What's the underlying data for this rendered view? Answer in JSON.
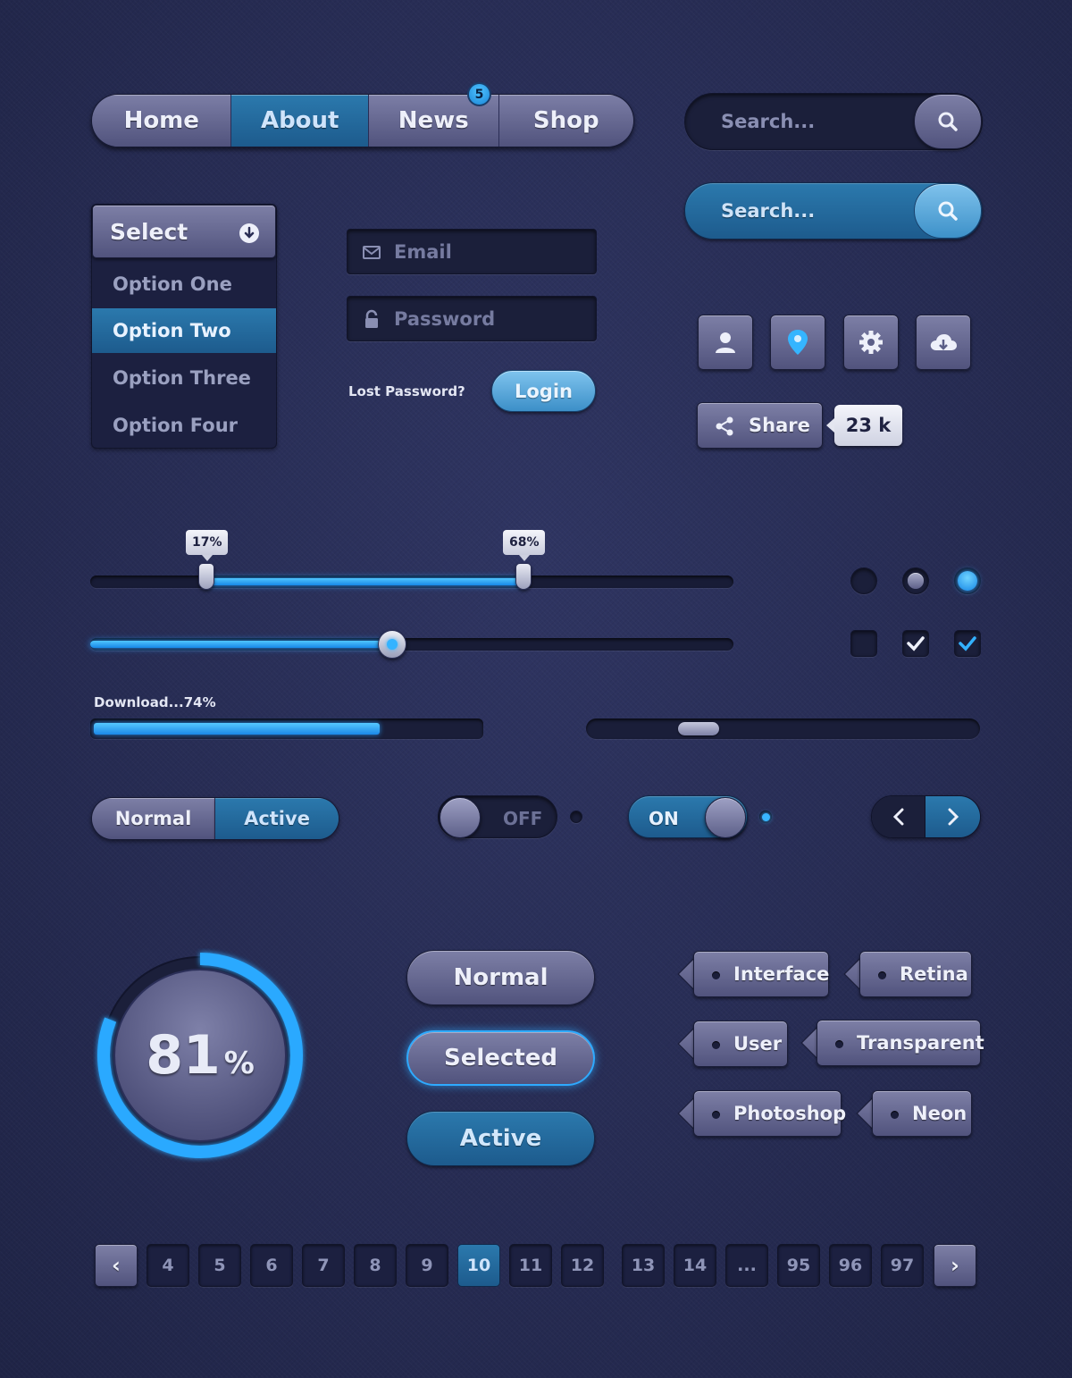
{
  "nav": {
    "items": [
      "Home",
      "About",
      "News",
      "Shop"
    ],
    "active": "About",
    "badge": "5"
  },
  "search": {
    "dark_placeholder": "Search...",
    "blue_placeholder": "Search..."
  },
  "select": {
    "label": "Select",
    "options": [
      "Option One",
      "Option Two",
      "Option Three",
      "Option Four"
    ],
    "selected": "Option Two"
  },
  "login": {
    "email_placeholder": "Email",
    "password_placeholder": "Password",
    "lost_password": "Lost Password?",
    "login_label": "Login"
  },
  "icons": [
    "user-icon",
    "location-pin-icon",
    "gear-icon",
    "cloud-download-icon"
  ],
  "share": {
    "label": "Share",
    "count": "23 k"
  },
  "range_slider": {
    "low_label": "17%",
    "high_label": "68%",
    "low": 0.17,
    "high": 0.68
  },
  "slider": {
    "value": 0.47
  },
  "radios": [
    "empty",
    "unchecked",
    "checked"
  ],
  "checkboxes": [
    "empty",
    "checked-white",
    "checked-blue"
  ],
  "download": {
    "label": "Download...74%",
    "value": 0.74
  },
  "scrollbar": {
    "position": 0.25
  },
  "segmented": {
    "normal_label": "Normal",
    "active_label": "Active"
  },
  "toggles": {
    "off_label": "OFF",
    "on_label": "ON"
  },
  "circle_progress": {
    "value": "81",
    "unit": "%",
    "fraction": 0.81
  },
  "buttons": {
    "normal": "Normal",
    "selected": "Selected",
    "active": "Active"
  },
  "tags": [
    "Interface",
    "Retina",
    "User",
    "Transparent",
    "Photoshop",
    "Neon"
  ],
  "pagination": {
    "prev": "‹",
    "next": "›",
    "pages": [
      "4",
      "5",
      "6",
      "7",
      "8",
      "9",
      "10",
      "11",
      "12",
      "13",
      "14",
      "...",
      "95",
      "96",
      "97"
    ],
    "current": "10"
  },
  "colors": {
    "accent": "#1f8fe8",
    "glow": "#2ea6ff",
    "background": "#272c54"
  }
}
